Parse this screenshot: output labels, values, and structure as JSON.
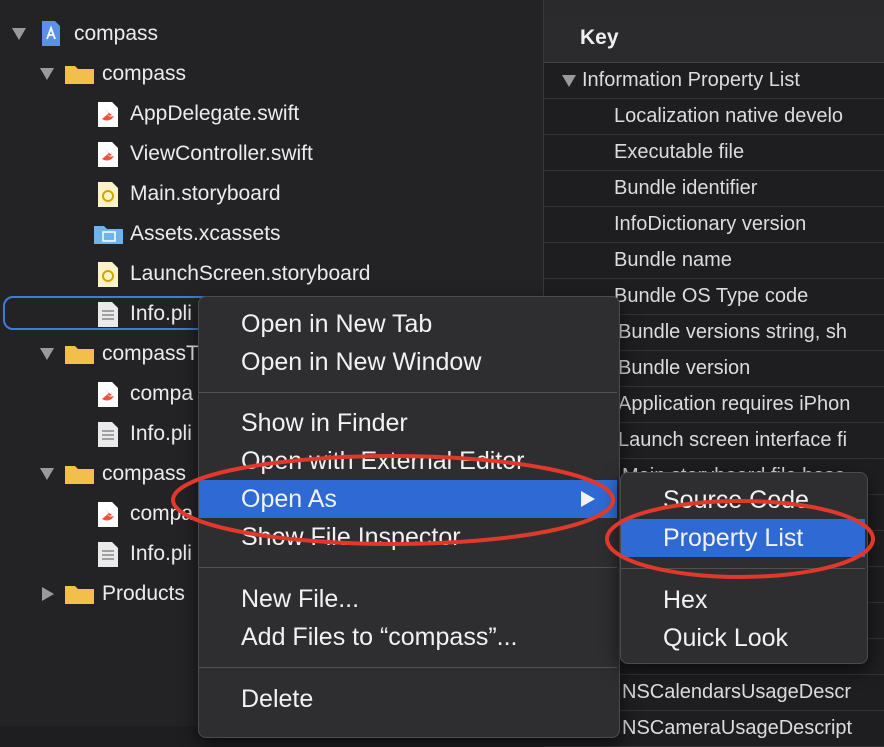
{
  "navigator": {
    "items": [
      {
        "label": "compass",
        "kind": "project"
      },
      {
        "label": "compass",
        "kind": "folder"
      },
      {
        "label": "AppDelegate.swift",
        "kind": "swift"
      },
      {
        "label": "ViewController.swift",
        "kind": "swift"
      },
      {
        "label": "Main.storyboard",
        "kind": "storyboard"
      },
      {
        "label": "Assets.xcassets",
        "kind": "assets"
      },
      {
        "label": "LaunchScreen.storyboard",
        "kind": "storyboard"
      },
      {
        "label": "Info.pli",
        "kind": "plist"
      },
      {
        "label": "compassT",
        "kind": "folder"
      },
      {
        "label": "compa",
        "kind": "swift"
      },
      {
        "label": "Info.pli",
        "kind": "plist"
      },
      {
        "label": "compass",
        "kind": "folder"
      },
      {
        "label": "compa",
        "kind": "swift"
      },
      {
        "label": "Info.pli",
        "kind": "plist"
      },
      {
        "label": "Products",
        "kind": "folder"
      }
    ]
  },
  "editor": {
    "header": "Key",
    "root": "Information Property List",
    "rows": [
      "Localization native develo",
      "Executable file",
      "Bundle identifier",
      "InfoDictionary version",
      "Bundle name",
      "Bundle OS Type code",
      "Bundle versions string, sh",
      "Bundle version",
      "Application requires iPhon",
      "Launch screen interface fi",
      "Main storyboard file base",
      "",
      "",
      "",
      "",
      "",
      "NSCalendarsUsageDescr",
      "NSCameraUsageDescript"
    ]
  },
  "context_menu": {
    "items": [
      "Open in New Tab",
      "Open in New Window",
      "Show in Finder",
      "Open with External Editor",
      "Open As",
      "Show File Inspector",
      "New File...",
      "Add Files to “compass”...",
      "Delete"
    ]
  },
  "submenu": {
    "items": [
      "Source Code",
      "Property List",
      "Hex",
      "Quick Look"
    ]
  },
  "colors": {
    "highlight": "#2f6ad4",
    "annotation": "#e0392b",
    "folder": "#f2c04a",
    "swift": "#f05138"
  }
}
